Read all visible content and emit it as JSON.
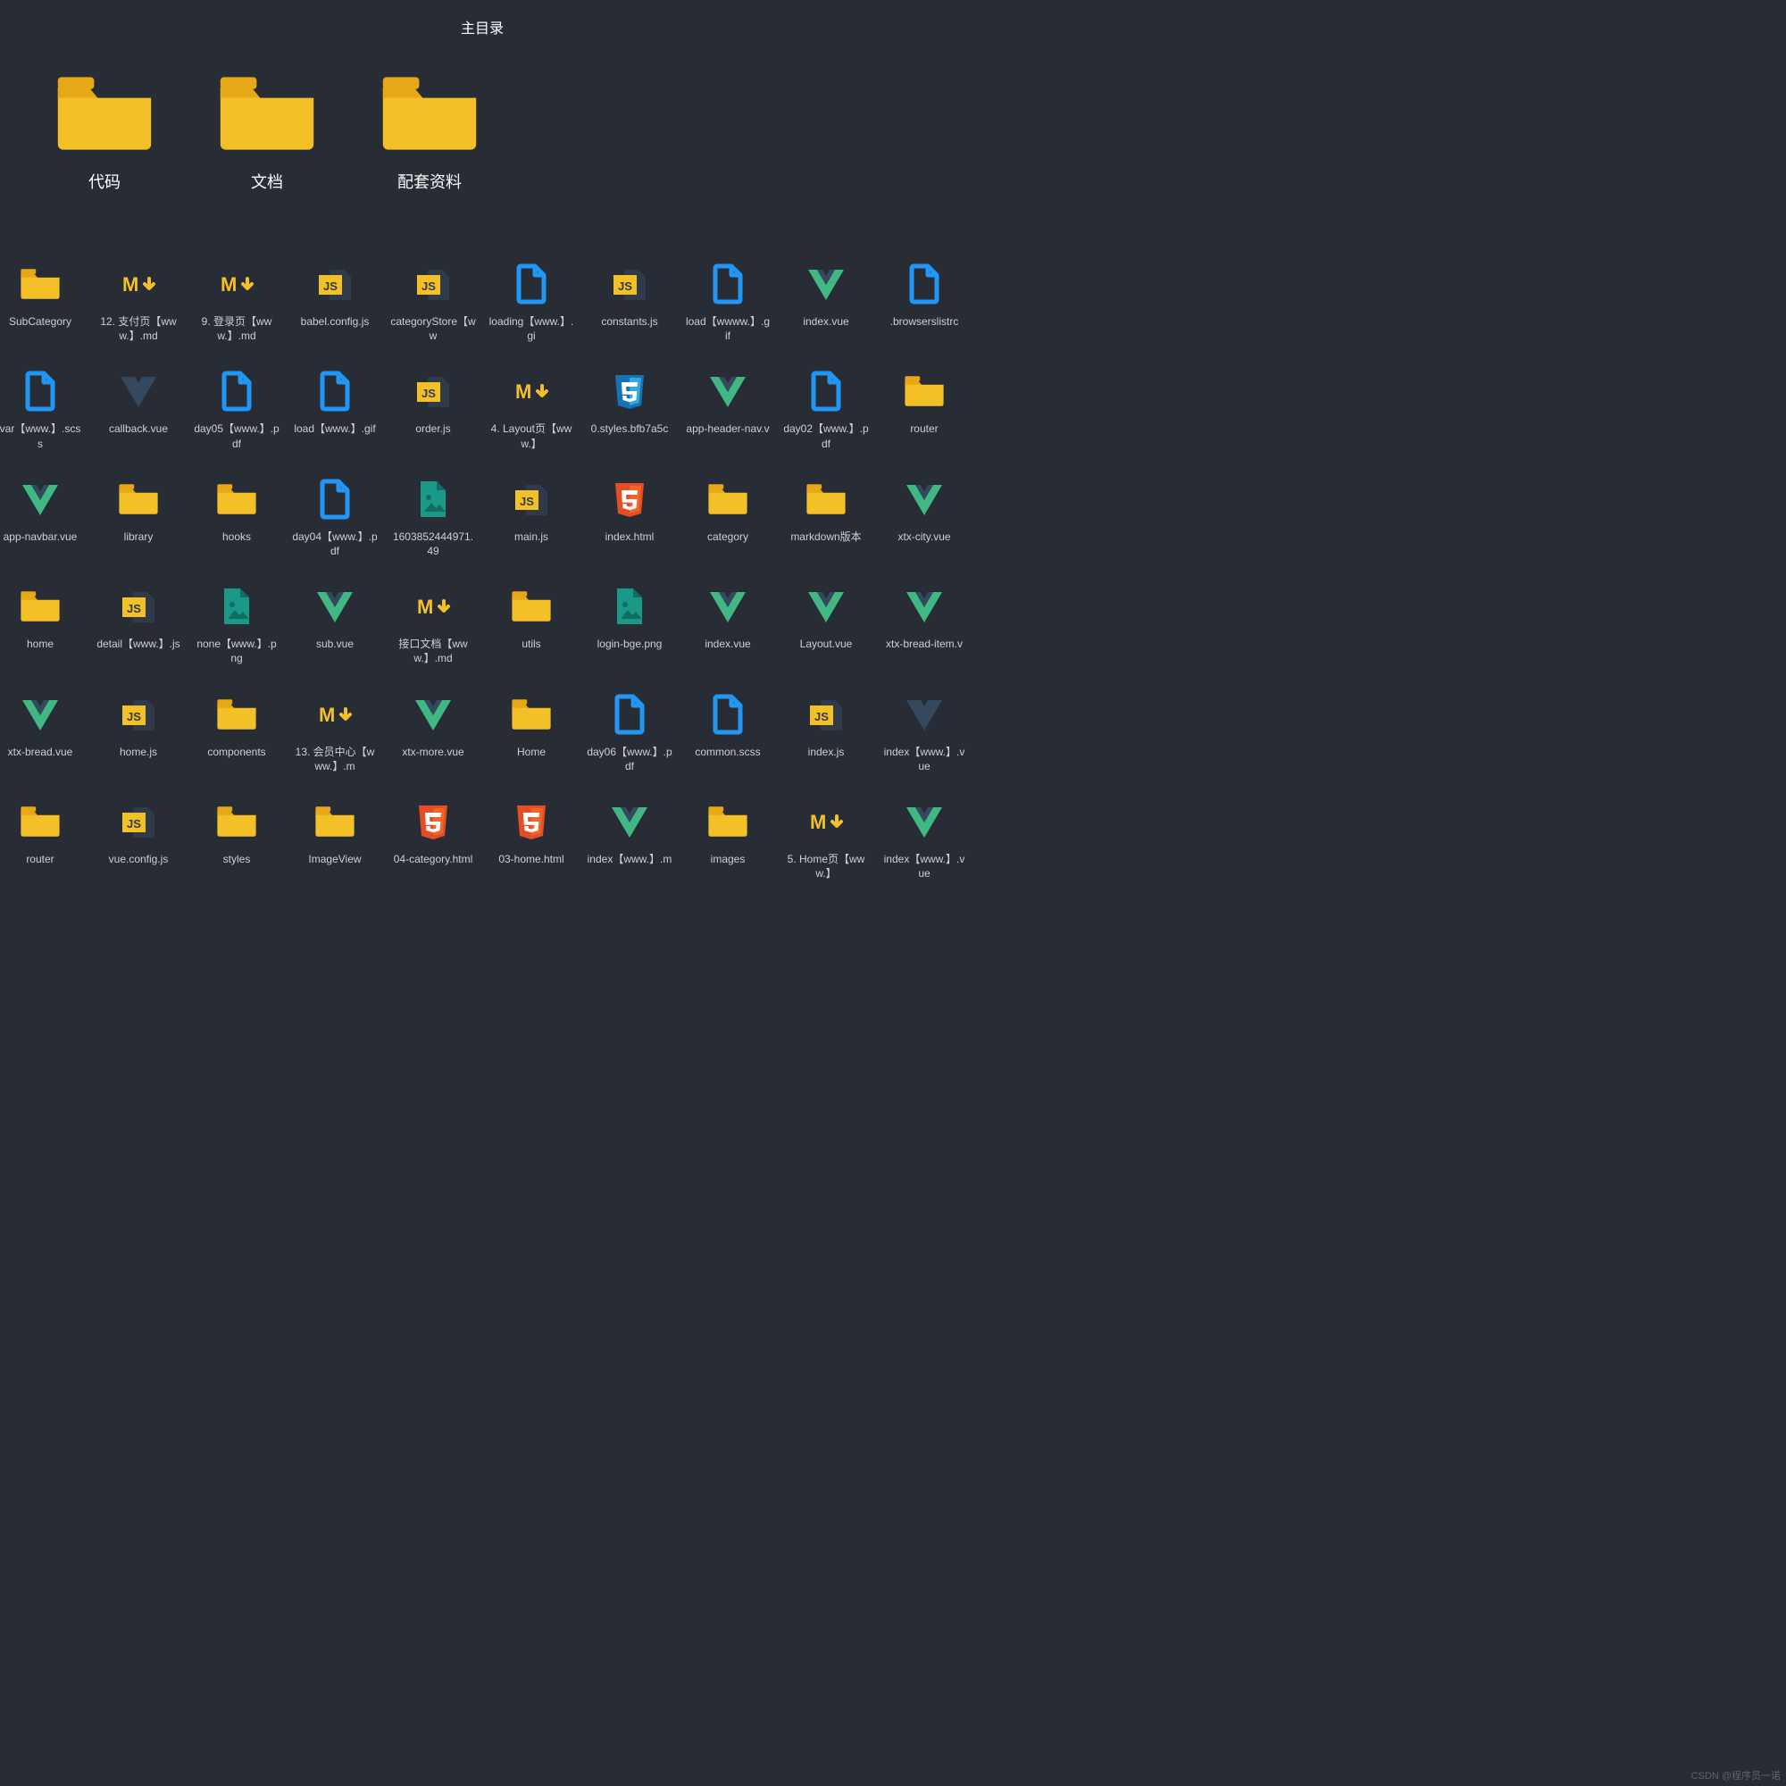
{
  "title": "主目录",
  "watermark": "CSDN @程序员一诺",
  "colors": {
    "yellow": "#f4c028",
    "yellow_dark": "#e6a817",
    "blue": "#2196f3",
    "teal": "#1a9988",
    "teal_d": "#116d61",
    "vue_g": "#41b883",
    "vue_d": "#35495e",
    "html5": "#e44d26",
    "css3": "#1572b6",
    "slate": "#2f3b4a"
  },
  "top": [
    {
      "label": "代码",
      "icon": "folder"
    },
    {
      "label": "文档",
      "icon": "folder"
    },
    {
      "label": "配套资料",
      "icon": "folder"
    }
  ],
  "items": [
    {
      "label": "SubCategory",
      "icon": "folder"
    },
    {
      "label": "12. 支付页【www.】.md",
      "icon": "md"
    },
    {
      "label": "9. 登录页【www.】.md",
      "icon": "md"
    },
    {
      "label": "babel.config.js",
      "icon": "js"
    },
    {
      "label": "categoryStore【ww",
      "icon": "js"
    },
    {
      "label": "loading【www.】.gi",
      "icon": "file-blue"
    },
    {
      "label": "constants.js",
      "icon": "js"
    },
    {
      "label": "load【wwww.】.gif",
      "icon": "file-blue"
    },
    {
      "label": "index.vue",
      "icon": "vue"
    },
    {
      "label": ".browserslistrc",
      "icon": "file-blue"
    },
    {
      "label": "var【www.】.scss",
      "icon": "file-blue"
    },
    {
      "label": "callback.vue",
      "icon": "vue-dark"
    },
    {
      "label": "day05【www.】.pdf",
      "icon": "file-blue"
    },
    {
      "label": "load【www.】.gif",
      "icon": "file-blue"
    },
    {
      "label": "order.js",
      "icon": "js"
    },
    {
      "label": "4. Layout页【www.】",
      "icon": "md"
    },
    {
      "label": "0.styles.bfb7a5c",
      "icon": "css3"
    },
    {
      "label": "app-header-nav.v",
      "icon": "vue"
    },
    {
      "label": "day02【www.】.pdf",
      "icon": "file-blue"
    },
    {
      "label": "router",
      "icon": "folder"
    },
    {
      "label": "app-navbar.vue",
      "icon": "vue"
    },
    {
      "label": "library",
      "icon": "folder"
    },
    {
      "label": "hooks",
      "icon": "folder"
    },
    {
      "label": "day04【www.】.pdf",
      "icon": "file-blue"
    },
    {
      "label": "1603852444971.49",
      "icon": "image-teal"
    },
    {
      "label": "main.js",
      "icon": "js"
    },
    {
      "label": "index.html",
      "icon": "html5"
    },
    {
      "label": "category",
      "icon": "folder"
    },
    {
      "label": "markdown版本",
      "icon": "folder"
    },
    {
      "label": "xtx-city.vue",
      "icon": "vue"
    },
    {
      "label": "home",
      "icon": "folder"
    },
    {
      "label": "detail【www.】.js",
      "icon": "js"
    },
    {
      "label": "none【www.】.png",
      "icon": "image-teal"
    },
    {
      "label": "sub.vue",
      "icon": "vue"
    },
    {
      "label": "接口文档【www.】.md",
      "icon": "md"
    },
    {
      "label": "utils",
      "icon": "folder"
    },
    {
      "label": "login-bge.png",
      "icon": "image-teal"
    },
    {
      "label": "index.vue",
      "icon": "vue"
    },
    {
      "label": "Layout.vue",
      "icon": "vue"
    },
    {
      "label": "xtx-bread-item.v",
      "icon": "vue"
    },
    {
      "label": "xtx-bread.vue",
      "icon": "vue"
    },
    {
      "label": "home.js",
      "icon": "js"
    },
    {
      "label": "components",
      "icon": "folder"
    },
    {
      "label": "13. 会员中心【www.】.m",
      "icon": "md"
    },
    {
      "label": "xtx-more.vue",
      "icon": "vue"
    },
    {
      "label": "Home",
      "icon": "folder"
    },
    {
      "label": "day06【www.】.pdf",
      "icon": "file-blue"
    },
    {
      "label": "common.scss",
      "icon": "file-blue"
    },
    {
      "label": "index.js",
      "icon": "js"
    },
    {
      "label": "index【www.】.vue",
      "icon": "vue-dark"
    },
    {
      "label": "router",
      "icon": "folder"
    },
    {
      "label": "vue.config.js",
      "icon": "js"
    },
    {
      "label": "styles",
      "icon": "folder"
    },
    {
      "label": "ImageView",
      "icon": "folder"
    },
    {
      "label": "04-category.html",
      "icon": "html5"
    },
    {
      "label": "03-home.html",
      "icon": "html5"
    },
    {
      "label": "index【www.】.m",
      "icon": "vue"
    },
    {
      "label": "images",
      "icon": "folder"
    },
    {
      "label": "5. Home页【www.】",
      "icon": "md"
    },
    {
      "label": "index【www.】.vue",
      "icon": "vue"
    }
  ]
}
